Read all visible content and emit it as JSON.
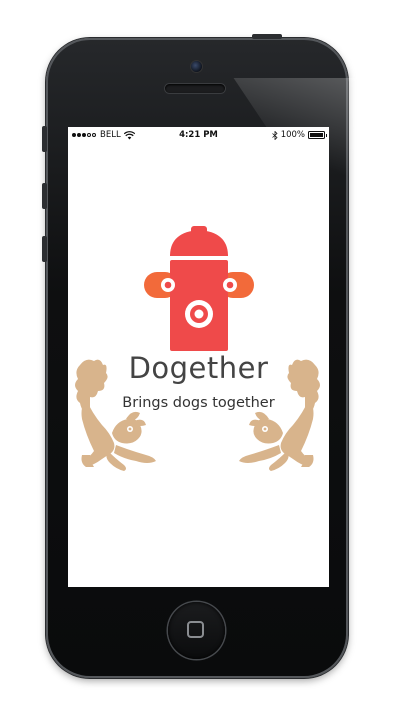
{
  "status_bar": {
    "carrier": "BELL",
    "time": "4:21 PM",
    "battery": "100%",
    "signal_icon": "signal-dots-icon",
    "wifi_icon": "wifi-icon",
    "bluetooth_icon": "bluetooth-icon",
    "battery_icon": "battery-icon"
  },
  "splash": {
    "app_name": "Dogether",
    "tagline": "Brings dogs together",
    "logo_icon": "fire-hydrant-icon",
    "mascot_icon": "dog-icon"
  },
  "colors": {
    "hydrant_top": "#ef4a4a",
    "hydrant_body": "#ef4a4a",
    "hydrant_arms": "#f26a3a",
    "dog": "#d8b48c",
    "text": "#444444",
    "device_frame": "#0e0f10"
  }
}
